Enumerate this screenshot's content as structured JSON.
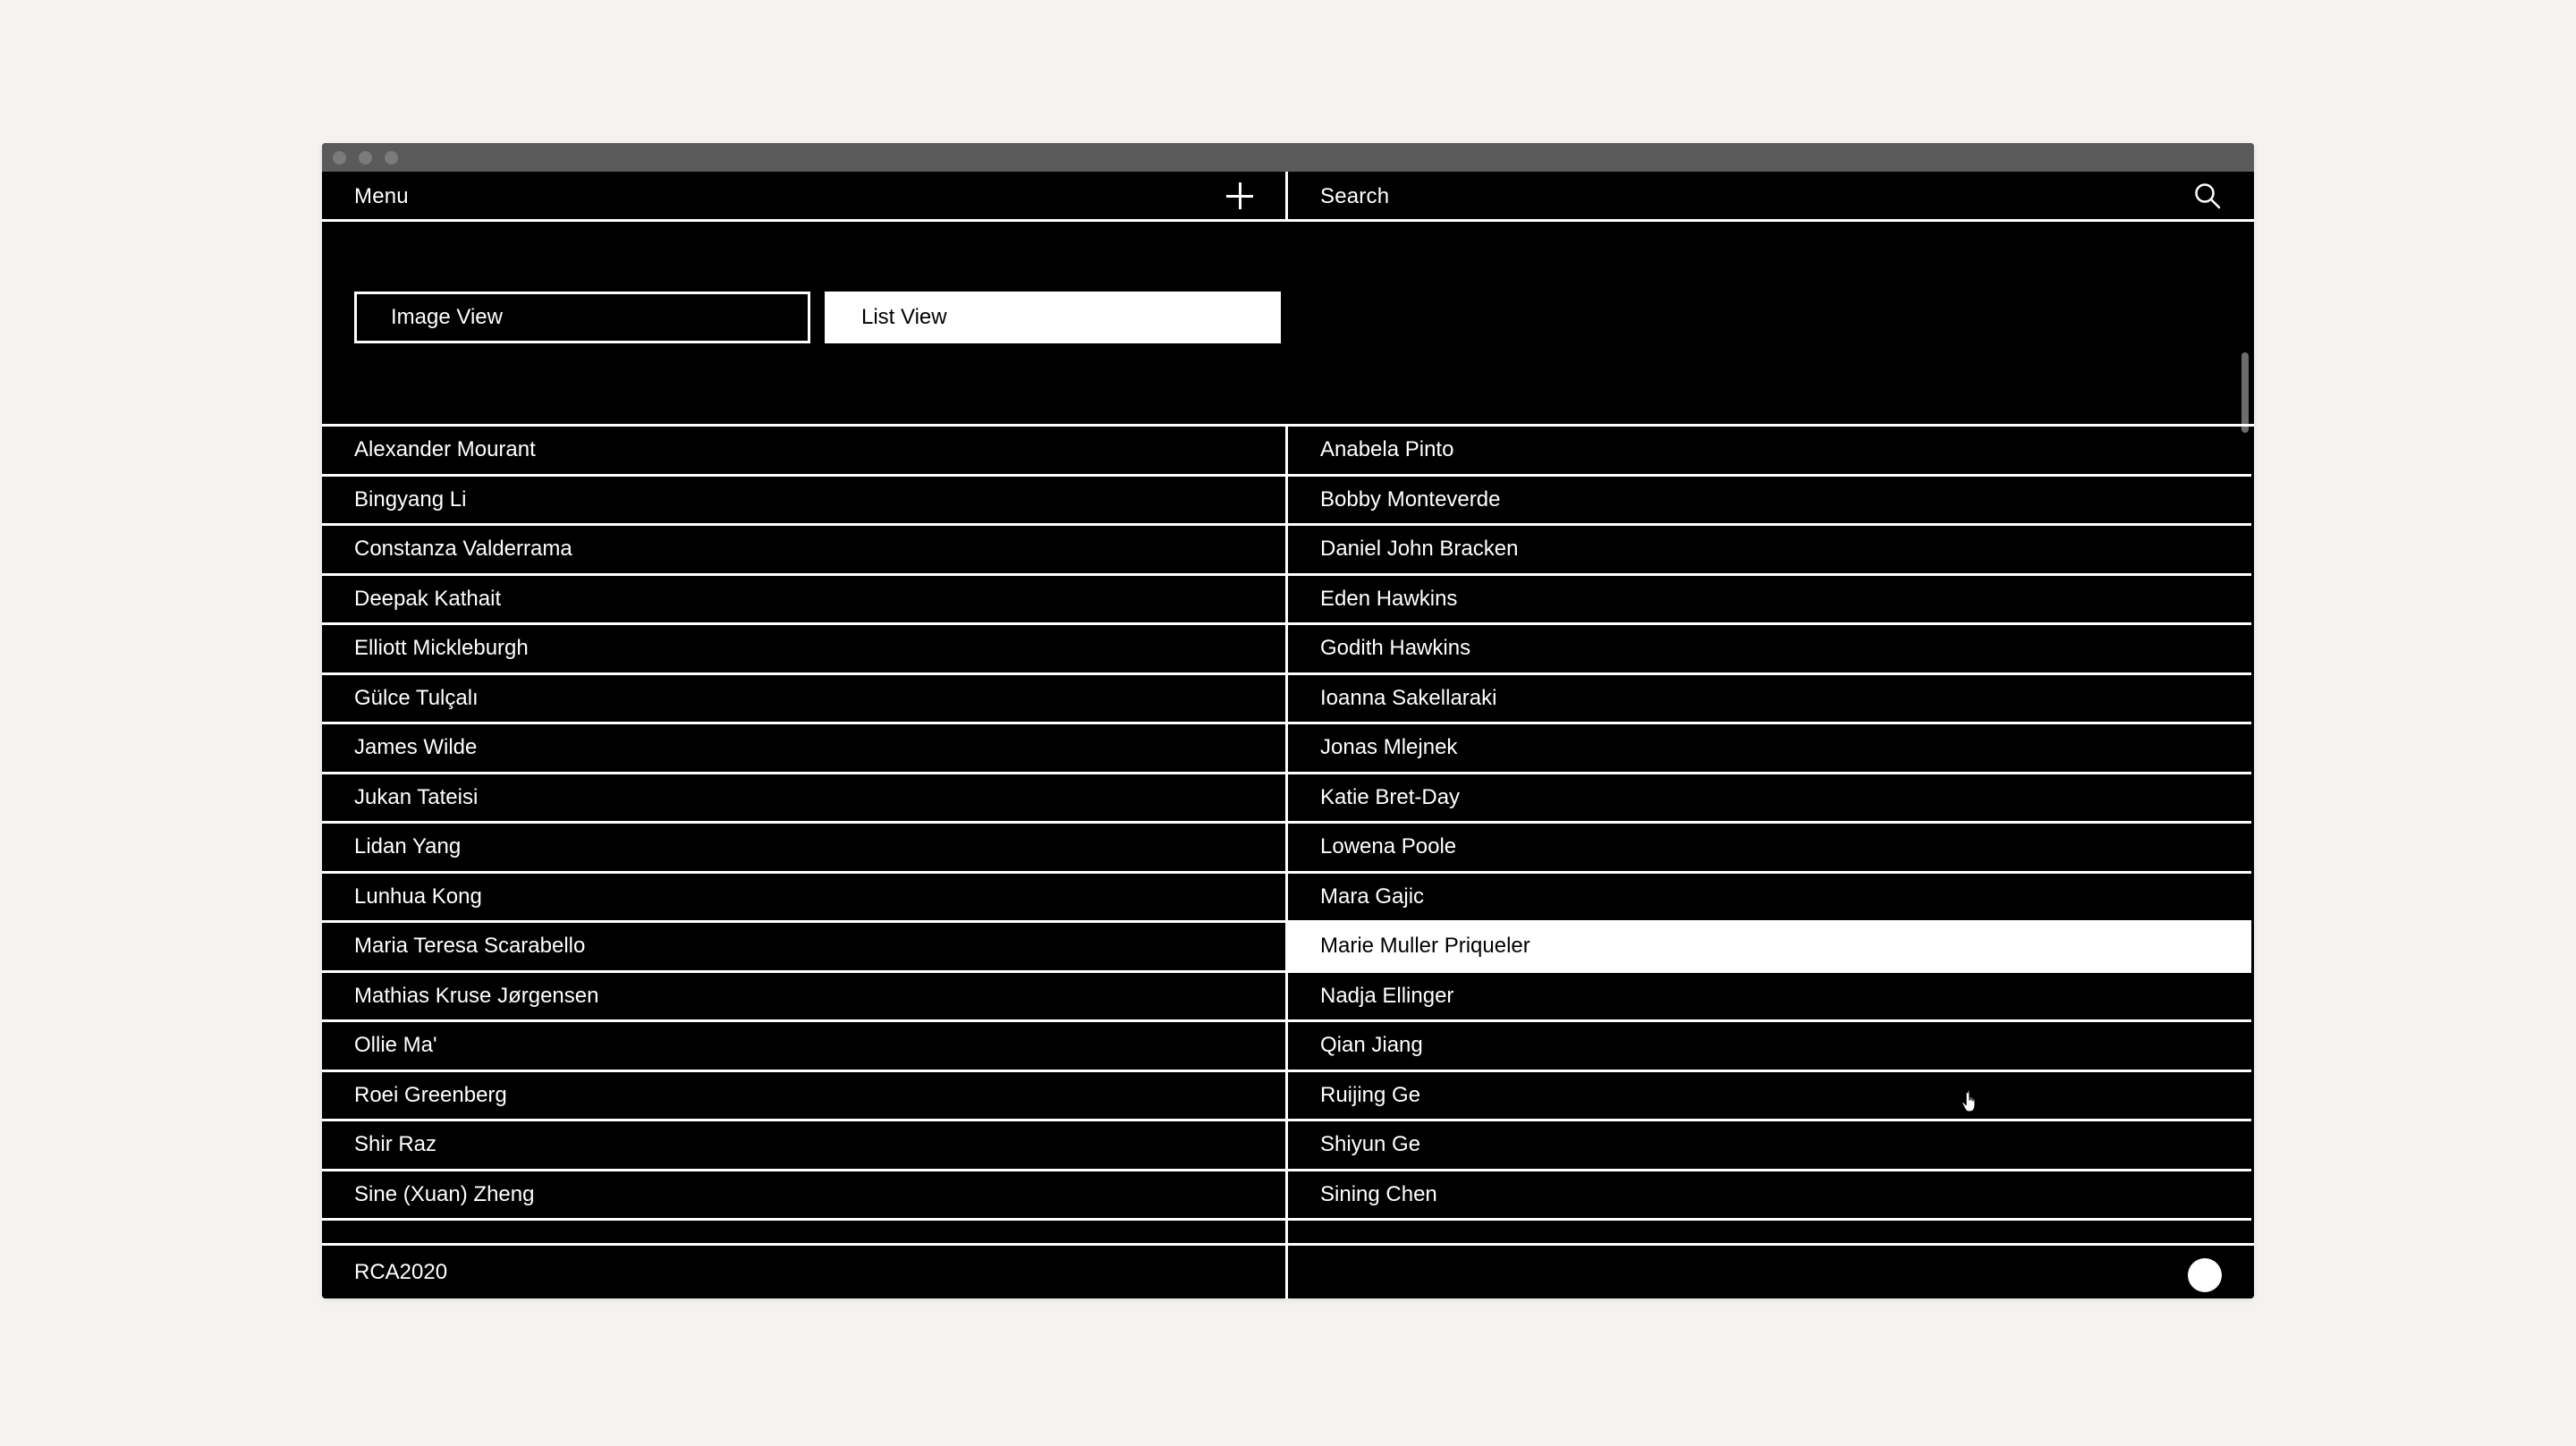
{
  "header": {
    "menu_label": "Menu",
    "search_label": "Search"
  },
  "views": {
    "image_view_label": "Image View",
    "list_view_label": "List View",
    "selected": "List View"
  },
  "list": {
    "left": [
      "Alexander Mourant",
      "Bingyang Li",
      "Constanza Valderrama",
      "Deepak Kathait",
      "Elliott Mickleburgh",
      "Gülce Tulçalı",
      "James Wilde",
      "Jukan Tateisi",
      "Lidan Yang",
      "Lunhua Kong",
      "Maria Teresa Scarabello",
      "Mathias Kruse Jørgensen",
      "Ollie Ma'",
      "Roei Greenberg",
      "Shir Raz",
      "Sine (Xuan) Zheng"
    ],
    "right": [
      "Anabela Pinto",
      "Bobby Monteverde",
      "Daniel John Bracken",
      "Eden Hawkins",
      "Godith Hawkins",
      "Ioanna Sakellaraki",
      "Jonas Mlejnek",
      "Katie Bret-Day",
      "Lowena Poole",
      "Mara Gajic",
      "Marie Muller Priqueler",
      "Nadja Ellinger",
      "Qian Jiang",
      "Ruijing Ge",
      "Shiyun Ge",
      "Sining Chen"
    ],
    "highlighted": "Marie Muller Priqueler"
  },
  "footer": {
    "label": "RCA2020"
  },
  "colors": {
    "background": "#000000",
    "foreground": "#ffffff",
    "page": "#f4f3ef"
  }
}
